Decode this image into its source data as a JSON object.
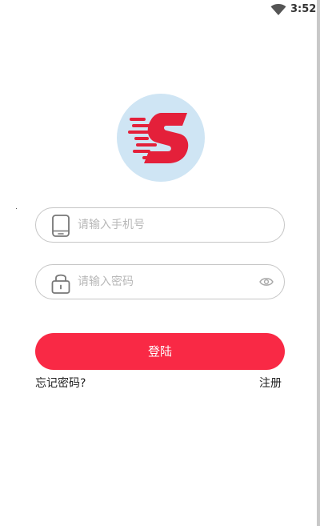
{
  "status_bar": {
    "time": "3:52",
    "wifi_icon": "wifi-icon"
  },
  "logo": {
    "letter": "S",
    "icon": "speed-s-logo",
    "background_color": "#cfe5f4",
    "brand_color": "#e4203a"
  },
  "form": {
    "phone": {
      "placeholder": "请输入手机号",
      "value": "",
      "icon": "phone-icon"
    },
    "password": {
      "placeholder": "请输入密码",
      "value": "",
      "icon": "lock-icon",
      "toggle_icon": "eye-icon"
    },
    "submit_label": "登陆"
  },
  "links": {
    "forgot_password": "忘记密码?",
    "register": "注册"
  },
  "colors": {
    "accent": "#f92945",
    "border": "#c6c6c6",
    "placeholder": "#b8b8b8"
  }
}
